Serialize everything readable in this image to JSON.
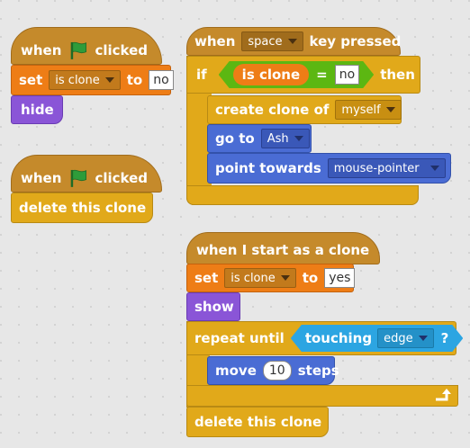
{
  "script1": {
    "hat": {
      "when": "when",
      "clicked": "clicked"
    },
    "set": {
      "set": "set",
      "var": "is clone",
      "to": "to",
      "value": "no"
    },
    "hide": "hide"
  },
  "script2": {
    "hat": {
      "when": "when",
      "clicked": "clicked"
    },
    "delete": "delete this clone"
  },
  "script3": {
    "hat": {
      "when": "when",
      "key": "space",
      "rest": "key pressed"
    },
    "if": {
      "if": "if",
      "var": "is clone",
      "eq": "=",
      "value": "no",
      "then": "then"
    },
    "create": {
      "label": "create clone of",
      "target": "myself"
    },
    "goto": {
      "label": "go to",
      "target": "Ash"
    },
    "point": {
      "label": "point towards",
      "target": "mouse-pointer"
    }
  },
  "script4": {
    "hat": "when I start as a clone",
    "set": {
      "set": "set",
      "var": "is clone",
      "to": "to",
      "value": "yes"
    },
    "show": "show",
    "repeat": {
      "label": "repeat until",
      "touching": "touching",
      "target": "edge",
      "q": "?"
    },
    "move": {
      "move": "move",
      "steps_value": "10",
      "steps": "steps"
    },
    "delete": "delete this clone"
  },
  "colors": {
    "events": "#c58a2b",
    "control": "#e1a91a",
    "data": "#ee7d16",
    "looks": "#8a55d7",
    "motion": "#4a6cd4",
    "sensing": "#2ca5e2",
    "operators": "#5cb712",
    "flag": "#2e9c3a"
  }
}
